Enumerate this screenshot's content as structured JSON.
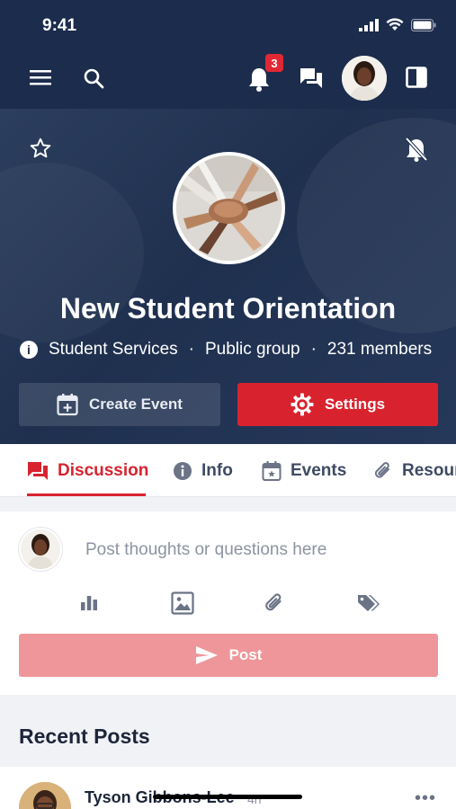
{
  "status_bar": {
    "time": "9:41"
  },
  "topbar": {
    "notification_count": "3"
  },
  "group": {
    "name": "New Student Orientation",
    "category": "Student Services",
    "separator": "·",
    "visibility": "Public group",
    "members": "231 members",
    "create_event_label": "Create Event",
    "settings_label": "Settings"
  },
  "tabs": [
    {
      "label": "Discussion",
      "icon": "discussion-icon",
      "active": true
    },
    {
      "label": "Info",
      "icon": "info-icon",
      "active": false
    },
    {
      "label": "Events",
      "icon": "calendar-icon",
      "active": false
    },
    {
      "label": "Resour",
      "icon": "paperclip-icon",
      "active": false
    }
  ],
  "composer": {
    "placeholder": "Post thoughts or questions here",
    "tools": [
      "poll-icon",
      "image-icon",
      "attachment-icon",
      "tag-icon"
    ],
    "post_label": "Post"
  },
  "recent": {
    "title": "Recent Posts",
    "first_post_author": "Tyson Gibbons-Lee",
    "first_post_time": "4h"
  },
  "colors": {
    "navy": "#1c2c4c",
    "accent_red": "#d8232f",
    "post_button_disabled": "#ee9699"
  }
}
